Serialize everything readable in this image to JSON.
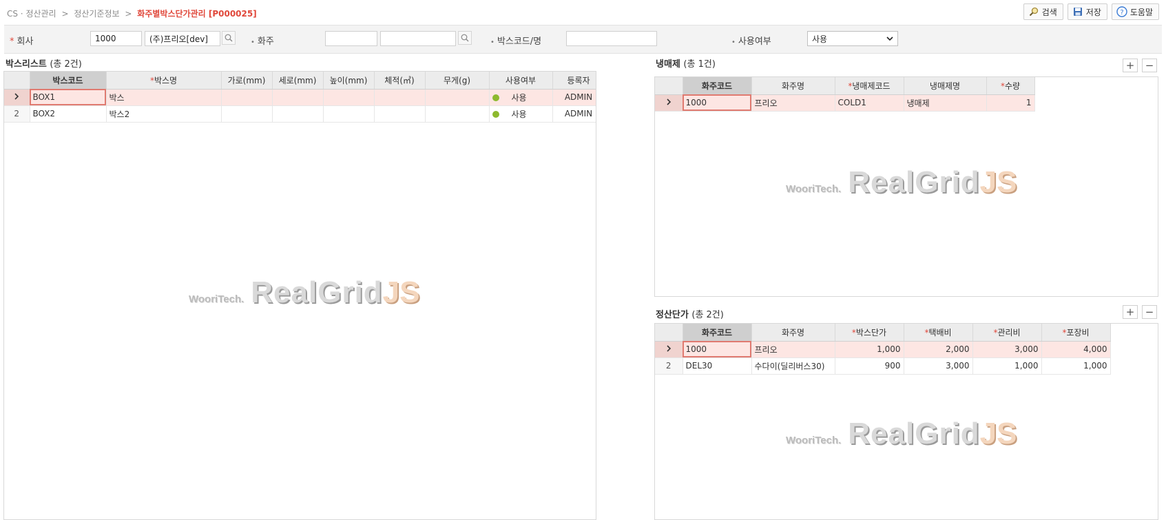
{
  "breadcrumb": {
    "items": [
      "CS · 정산관리",
      "정산기준정보"
    ],
    "sep": ">",
    "current": "화주별박스단가관리 [P000025]"
  },
  "actions": {
    "search": "검색",
    "save": "저장",
    "help": "도움말"
  },
  "search": {
    "company_label": "회사",
    "company_code": "1000",
    "company_name": "(주)프리오[dev]",
    "shipper_label": "화주",
    "shipper_code": "",
    "shipper_name": "",
    "box_label": "박스코드/명",
    "box_value": "",
    "use_label": "사용여부",
    "use_value": "사용"
  },
  "box_list": {
    "title": "박스리스트",
    "count": "(총 2건)",
    "columns": [
      "박스코드",
      "박스명",
      "가로(mm)",
      "세로(mm)",
      "높이(mm)",
      "체적(㎥)",
      "무게(g)",
      "사용여부",
      "등록자"
    ],
    "rows": [
      {
        "idx": "›",
        "code": "BOX1",
        "name": "박스",
        "w": "",
        "d": "",
        "h": "",
        "vol": "",
        "weight": "",
        "use": "사용",
        "reg": "ADMIN"
      },
      {
        "idx": "2",
        "code": "BOX2",
        "name": "박스2",
        "w": "",
        "d": "",
        "h": "",
        "vol": "",
        "weight": "",
        "use": "사용",
        "reg": "ADMIN"
      }
    ]
  },
  "coolant": {
    "title": "냉매제",
    "count": "(총 1건)",
    "columns": [
      "화주코드",
      "화주명",
      "냉매제코드",
      "냉매제명",
      "수량"
    ],
    "rows": [
      {
        "idx": "›",
        "code": "1000",
        "name": "프리오",
        "ccode": "COLD1",
        "cname": "냉매제",
        "qty": "1"
      }
    ]
  },
  "price": {
    "title": "정산단가",
    "count": "(총 2건)",
    "columns": [
      "화주코드",
      "화주명",
      "박스단가",
      "택배비",
      "관리비",
      "포장비"
    ],
    "rows": [
      {
        "idx": "›",
        "code": "1000",
        "name": "프리오",
        "box": "1,000",
        "courier": "2,000",
        "mgmt": "3,000",
        "pack": "4,000"
      },
      {
        "idx": "2",
        "code": "DEL30",
        "name": "수다이(딜리버스30)",
        "box": "900",
        "courier": "3,000",
        "mgmt": "1,000",
        "pack": "1,000"
      }
    ]
  },
  "watermark": {
    "brand": "WooriTech.",
    "product": "RealGrid",
    "suffix": "JS"
  },
  "colors": {
    "accent": "#e0483b",
    "selected_row": "#fde6e3",
    "status_dot": "#8db92e"
  },
  "icons": [
    "search-icon",
    "save-icon",
    "help-icon",
    "plus-icon",
    "minus-icon",
    "chevron-down-icon",
    "row-indicator-icon"
  ]
}
